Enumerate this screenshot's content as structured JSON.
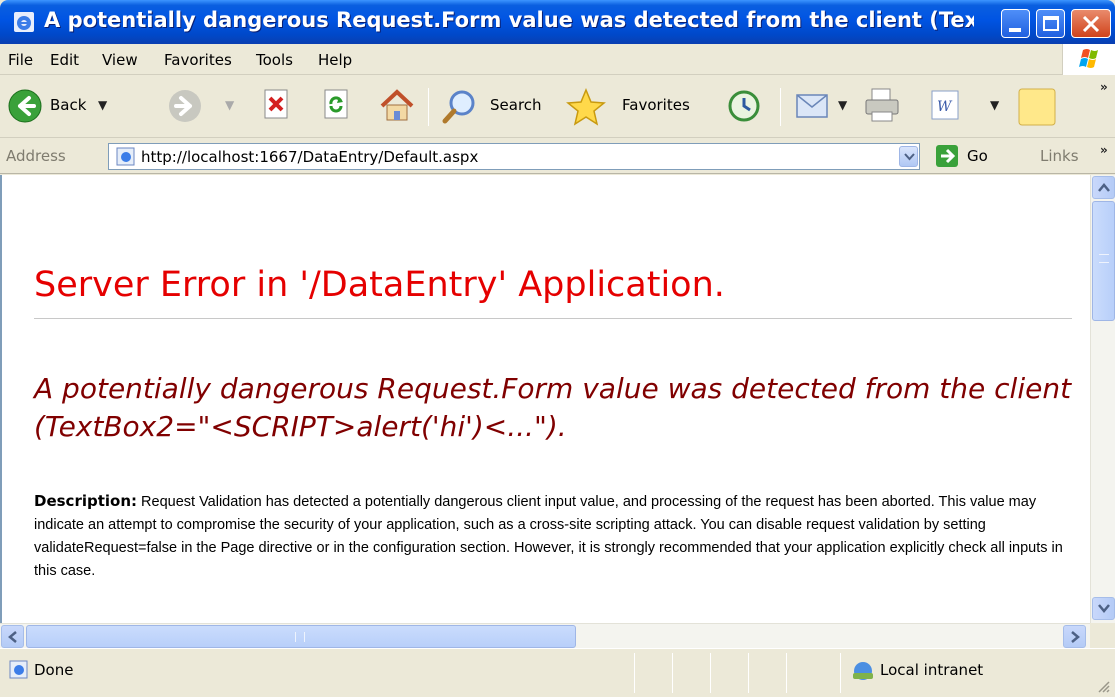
{
  "window": {
    "title": "A potentially dangerous Request.Form value was detected from the client (TextB..."
  },
  "menu": {
    "items": [
      {
        "label": "File"
      },
      {
        "label": "Edit"
      },
      {
        "label": "View"
      },
      {
        "label": "Favorites"
      },
      {
        "label": "Tools"
      },
      {
        "label": "Help"
      }
    ]
  },
  "toolbar": {
    "back_label": "Back",
    "search_label": "Search",
    "favorites_label": "Favorites"
  },
  "address": {
    "label": "Address",
    "url": "http://localhost:1667/DataEntry/Default.aspx",
    "go_label": "Go",
    "links_label": "Links"
  },
  "page": {
    "title": "Server Error in '/DataEntry' Application.",
    "subtitle": "A potentially dangerous Request.Form value was detected from the client (TextBox2=\"<SCRIPT>alert('hi')<...\").",
    "description_label": "Description:",
    "description_text": " Request Validation has detected a potentially dangerous client input value, and processing of the request has been aborted. This value may indicate an attempt to compromise the security of your application, such as a cross-site scripting attack. You can disable request validation by setting validateRequest=false in the Page directive or in the configuration section. However, it is strongly recommended that your application explicitly check all inputs in this case."
  },
  "status": {
    "text": "Done",
    "zone": "Local intranet"
  },
  "colors": {
    "title_bar": "#0054e3",
    "error_title": "#e50000",
    "error_subtitle": "#800000"
  }
}
